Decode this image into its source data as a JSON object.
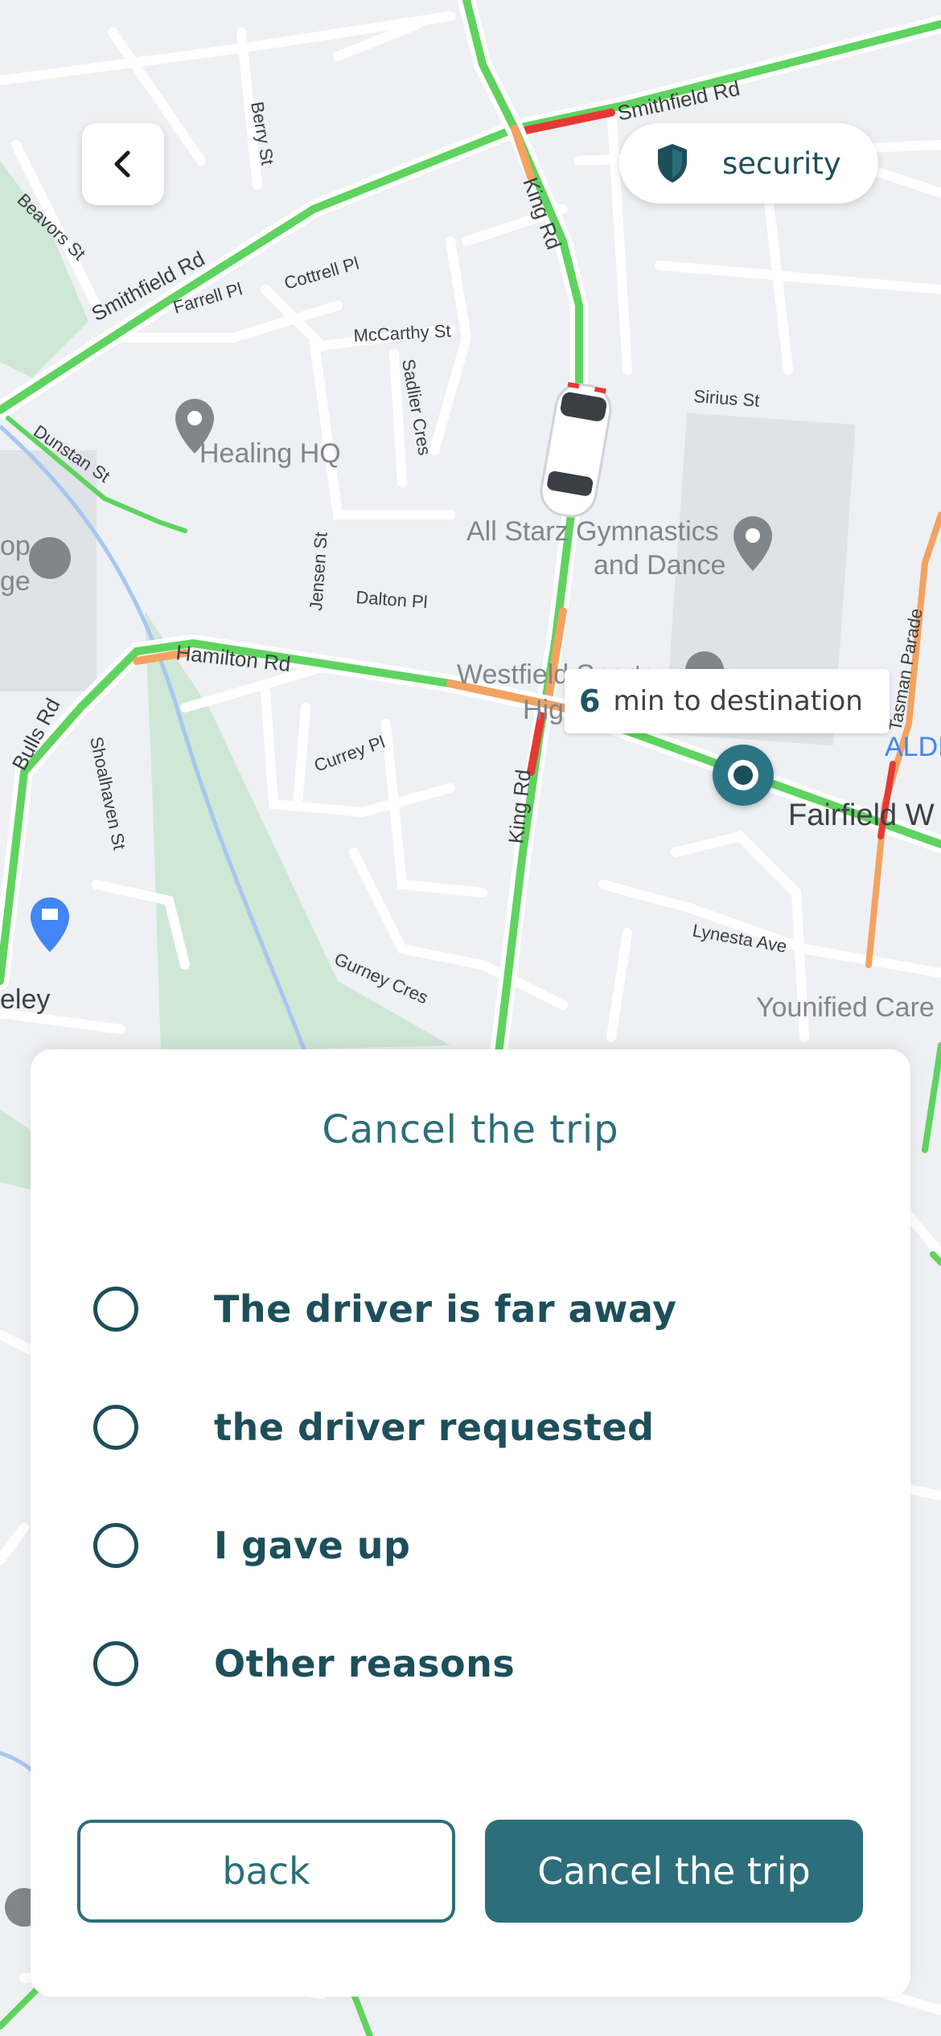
{
  "header": {
    "back_icon": "chevron-left-icon",
    "security_label": "security",
    "security_icon": "shield-icon"
  },
  "map": {
    "road_labels": [
      "Smithfield Rd",
      "Smithfield Rd",
      "King Rd",
      "King Rd",
      "Hamilton Rd",
      "Bulls Rd",
      "Dunstan St",
      "McCarthy St",
      "Sadlier Cres",
      "Jensen St",
      "Dalton Pl",
      "Currey Pl",
      "Shoalhaven St",
      "Gurney Cres",
      "Lynesta Ave",
      "Sirius St",
      "Farrell Pl",
      "Cottrell Pl",
      "Berry St",
      "Beavors St",
      "Tasman Parade",
      "Fairfield W"
    ],
    "poi_labels": [
      "Healing HQ",
      "All Starz Gymnastics",
      "and Dance",
      "Westfield Sports",
      "High",
      "Younified Care",
      "eley",
      "ALDI",
      "op",
      "ge"
    ]
  },
  "eta": {
    "minutes": "6",
    "label": "min to destination"
  },
  "cancel_sheet": {
    "title": "Cancel the trip",
    "options": [
      {
        "label": "The driver is far away"
      },
      {
        "label": "the driver requested"
      },
      {
        "label": "I gave up"
      },
      {
        "label": "Other reasons"
      }
    ],
    "back_label": "back",
    "confirm_label": "Cancel the trip"
  },
  "colors": {
    "primary": "#2c6e7b",
    "traffic_green": "#5fd35f",
    "traffic_red": "#e53935",
    "traffic_orange": "#f4a261"
  }
}
